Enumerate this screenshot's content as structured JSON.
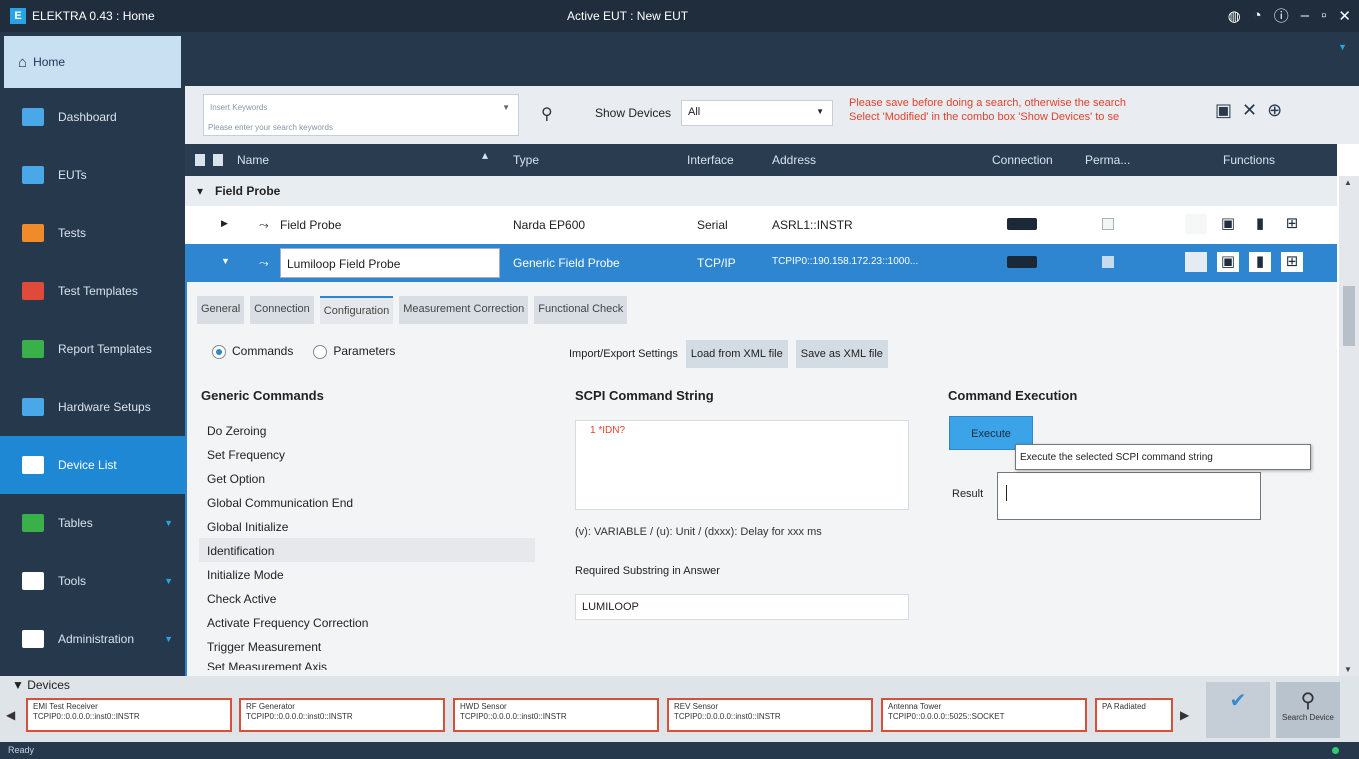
{
  "window": {
    "app_title": "ELEKTRA 0.43 : Home",
    "center_title": "Active EUT : New EUT",
    "icons": [
      "earth-icon",
      "clock-icon",
      "info-icon",
      "minimize-icon",
      "maximize-icon",
      "close-icon"
    ]
  },
  "sidebar": {
    "home": "Home",
    "items": [
      {
        "label": "Dashboard",
        "icon": "dashboard-icon",
        "color": "#4aa8e8"
      },
      {
        "label": "EUTs",
        "icon": "eut-icon",
        "color": "#4aa8e8"
      },
      {
        "label": "Tests",
        "icon": "tests-icon",
        "color": "#f08a2a"
      },
      {
        "label": "Test Templates",
        "icon": "templates-icon",
        "color": "#e04a3a"
      },
      {
        "label": "Report Templates",
        "icon": "report-icon",
        "color": "#3ab04a"
      },
      {
        "label": "Hardware Setups",
        "icon": "hardware-icon",
        "color": "#4aa8e8"
      },
      {
        "label": "Device List",
        "icon": "device-list-icon",
        "color": "#ffffff"
      },
      {
        "label": "Tables",
        "icon": "tables-icon",
        "color": "#3ab04a"
      },
      {
        "label": "Tools",
        "icon": "tools-icon",
        "color": "#ffffff"
      },
      {
        "label": "Administration",
        "icon": "admin-icon",
        "color": "#ffffff"
      }
    ]
  },
  "search": {
    "placeholder": "Insert Keywords",
    "hint": "Please enter your search keywords",
    "show_devices_label": "Show Devices",
    "show_devices_value": "All",
    "warning_line1": "Please save before doing a search, otherwise the search",
    "warning_line2": "Select 'Modified' in the combo box 'Show Devices' to se"
  },
  "table": {
    "headers": {
      "name": "Name",
      "type": "Type",
      "interface": "Interface",
      "address": "Address",
      "connection": "Connection",
      "perma": "Perma...",
      "functions": "Functions"
    },
    "group": "Field Probe",
    "rows": [
      {
        "name": "Field Probe",
        "type": "Narda EP600",
        "interface": "Serial",
        "address": "ASRL1::INSTR"
      },
      {
        "name": "Lumiloop Field Probe",
        "type": "Generic Field Probe",
        "interface": "TCP/IP",
        "address": "TCPIP0::190.158.172.23::1000..."
      }
    ]
  },
  "detail": {
    "tabs": [
      "General",
      "Connection",
      "Configuration",
      "Measurement Correction",
      "Functional Check"
    ],
    "radio_commands": "Commands",
    "radio_parameters": "Parameters",
    "import_export_label": "Import/Export Settings",
    "load_xml": "Load from XML file",
    "save_xml": "Save as XML file",
    "generic_commands_title": "Generic Commands",
    "commands": [
      "Do Zeroing",
      "Set Frequency",
      "Get Option",
      "Global Communication End",
      "Global Initialize",
      "Identification",
      "Initialize Mode",
      "Check Active",
      "Activate Frequency Correction",
      "Trigger Measurement",
      "Set Measurement Axis"
    ],
    "scpi_title": "SCPI Command String",
    "scpi_line": "1 *IDN?",
    "var_note": "(v): VARIABLE / (u): Unit / (dxxx): Delay for xxx ms",
    "required_label": "Required Substring in Answer",
    "required_value": "LUMILOOP",
    "exec_title": "Command Execution",
    "execute_btn": "Execute",
    "tooltip": "Execute the selected SCPI command string",
    "result_label": "Result"
  },
  "devices": {
    "header": "Devices",
    "cards": [
      {
        "title": "EMI Test Receiver",
        "addr": "TCPIP0::0.0.0.0::inst0::INSTR"
      },
      {
        "title": "RF Generator",
        "addr": "TCPIP0::0.0.0.0::inst0::INSTR"
      },
      {
        "title": "HWD Sensor",
        "addr": "TCPIP0::0.0.0.0::inst0::INSTR"
      },
      {
        "title": "REV Sensor",
        "addr": "TCPIP0::0.0.0.0::inst0::INSTR"
      },
      {
        "title": "Antenna Tower",
        "addr": "TCPIP0::0.0.0.0::5025::SOCKET"
      },
      {
        "title": "PA Radiated",
        "addr": ""
      }
    ],
    "search_device": "Search Device"
  },
  "status": {
    "text": "Ready"
  }
}
